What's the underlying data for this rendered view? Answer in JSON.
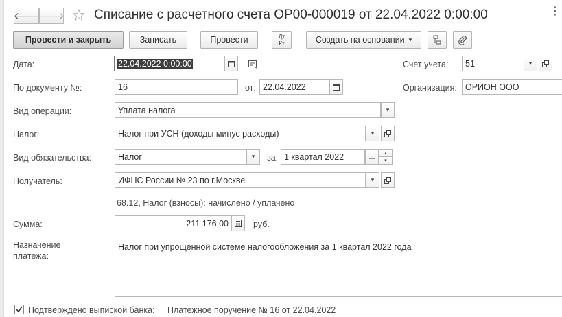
{
  "window": {
    "title": "Списание с расчетного счета ОР00-000019 от 22.04.2022 0:00:00",
    "back_glyph": "🡐",
    "forward_glyph": "🡒",
    "star_glyph": "☆",
    "more_glyph": "⋮"
  },
  "toolbar": {
    "post_close": "Провести и закрыть",
    "save": "Записать",
    "post": "Провести",
    "dt_kt_top": "Дт",
    "dt_kt_bottom": "Кт",
    "create_based": "Создать на основании",
    "create_based_arrow": "▾"
  },
  "form": {
    "date": {
      "label": "Дата:",
      "value": "22.04.2022  0:00:00"
    },
    "account": {
      "label": "Счет учета:",
      "value": "51"
    },
    "by_doc": {
      "label": "По документу №:",
      "value": "16",
      "from_label": "от:",
      "from_value": "22.04.2022"
    },
    "org": {
      "label": "Организация:",
      "value": "ОРИОН ООО"
    },
    "operation": {
      "label": "Вид операции:",
      "value": "Уплата налога"
    },
    "tax": {
      "label": "Налог:",
      "value": "Налог при УСН (доходы минус расходы)"
    },
    "obligation": {
      "label": "Вид обязательства:",
      "value": "Налог",
      "period_label": "за:",
      "period_value": "1 квартал 2022",
      "dots": "..."
    },
    "recipient": {
      "label": "Получатель:",
      "value": "ИФНС России № 23 по г.Москве"
    },
    "account_link": "68.12, Налог (взносы): начислено / уплачено",
    "amount": {
      "label": "Сумма:",
      "value": "211 176,00",
      "currency": "руб."
    },
    "purpose": {
      "label_line1": "Назначение",
      "label_line2": "платежа:",
      "value": "Налог при упрощенной системе налогообложения за 1 квартал 2022 года"
    },
    "confirmed": {
      "label": "Подтверждено выпиской банка:",
      "checked": true,
      "link": "Платежное поручение № 16 от 22.04.2022"
    }
  }
}
